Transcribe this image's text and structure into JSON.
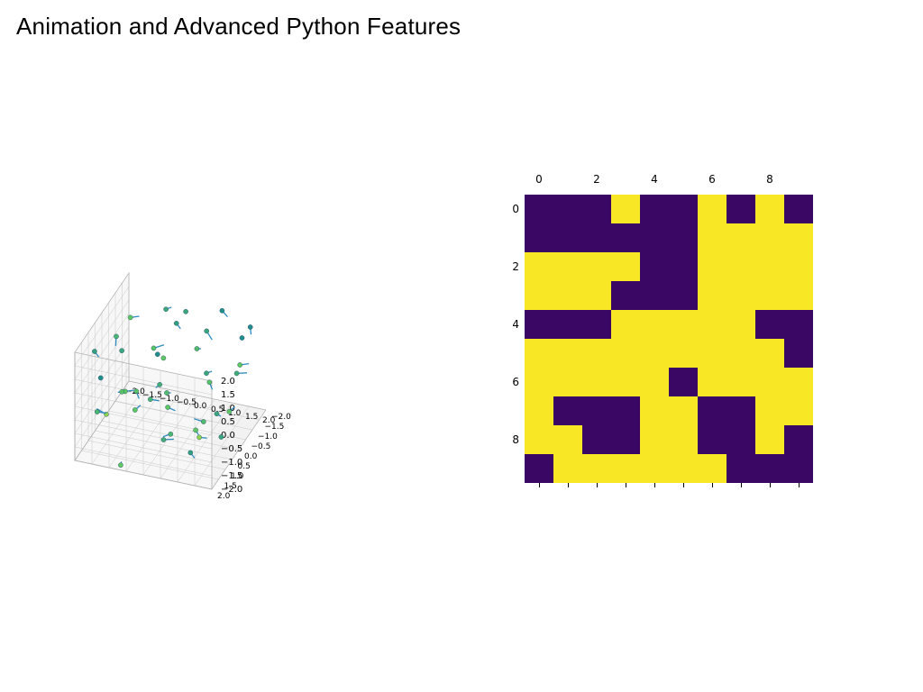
{
  "title": "Animation and Advanced Python Features",
  "chart_data": [
    {
      "type": "scatter",
      "subtype": "3d-quiver",
      "title": "",
      "x_ticks": [
        -2.0,
        -1.5,
        -1.0,
        -0.5,
        0.0,
        0.5,
        1.0,
        1.5,
        2.0
      ],
      "y_ticks": [
        -2.0,
        -1.5,
        -1.0,
        -0.5,
        0.0,
        0.5,
        1.0,
        1.5,
        2.0
      ],
      "z_ticks": [
        -2.0,
        -1.5,
        -1.0,
        -0.5,
        0.0,
        0.5,
        1.0,
        1.5,
        2.0
      ],
      "xlim": [
        -2.0,
        2.0
      ],
      "ylim": [
        -2.0,
        2.0
      ],
      "zlim": [
        -2.0,
        2.0
      ],
      "grid": true,
      "points": [
        {
          "x": -1.8,
          "y": -1.6,
          "z": 0.7,
          "u": 0.3,
          "v": 0.1,
          "w": 0.2
        },
        {
          "x": -1.5,
          "y": 0.2,
          "z": 1.4,
          "u": 0.1,
          "v": 0.3,
          "w": -0.1
        },
        {
          "x": -1.2,
          "y": 1.7,
          "z": -0.3,
          "u": -0.2,
          "v": 0.2,
          "w": 0.3
        },
        {
          "x": -0.9,
          "y": -0.8,
          "z": -1.5,
          "u": 0.3,
          "v": 0.1,
          "w": 0.1
        },
        {
          "x": -0.6,
          "y": 1.0,
          "z": 0.2,
          "u": 0.2,
          "v": 0.3,
          "w": 0.0
        },
        {
          "x": -0.3,
          "y": -1.9,
          "z": 1.1,
          "u": 0.1,
          "v": 0.2,
          "w": 0.2
        },
        {
          "x": 0.0,
          "y": 0.5,
          "z": -1.8,
          "u": 0.3,
          "v": 0.0,
          "w": 0.1
        },
        {
          "x": 0.3,
          "y": -1.2,
          "z": 0.4,
          "u": 0.2,
          "v": 0.2,
          "w": 0.2
        },
        {
          "x": 0.6,
          "y": 1.5,
          "z": -0.7,
          "u": -0.1,
          "v": 0.3,
          "w": 0.1
        },
        {
          "x": 0.9,
          "y": -0.4,
          "z": 1.8,
          "u": 0.2,
          "v": 0.1,
          "w": -0.2
        },
        {
          "x": 1.2,
          "y": 0.9,
          "z": -1.1,
          "u": 0.3,
          "v": 0.2,
          "w": 0.2
        },
        {
          "x": 1.5,
          "y": -1.5,
          "z": 0.9,
          "u": 0.1,
          "v": 0.2,
          "w": 0.1
        },
        {
          "x": 1.8,
          "y": 0.2,
          "z": -0.5,
          "u": 0.2,
          "v": 0.1,
          "w": 0.3
        },
        {
          "x": -1.7,
          "y": 1.3,
          "z": 1.6,
          "u": 0.2,
          "v": 0.2,
          "w": 0.0
        },
        {
          "x": -1.0,
          "y": -1.3,
          "z": 0.0,
          "u": 0.3,
          "v": 0.0,
          "w": 0.2
        },
        {
          "x": 0.4,
          "y": 1.8,
          "z": 1.3,
          "u": 0.0,
          "v": 0.3,
          "w": 0.1
        },
        {
          "x": 1.0,
          "y": -0.9,
          "z": -1.6,
          "u": 0.2,
          "v": 0.2,
          "w": 0.1
        },
        {
          "x": -0.2,
          "y": 0.0,
          "z": 0.8,
          "u": 0.1,
          "v": 0.3,
          "w": 0.2
        },
        {
          "x": 1.6,
          "y": 1.6,
          "z": 0.1,
          "u": -0.2,
          "v": 0.2,
          "w": 0.2
        },
        {
          "x": -1.9,
          "y": 0.6,
          "z": -1.2,
          "u": 0.3,
          "v": 0.1,
          "w": 0.1
        },
        {
          "x": 0.8,
          "y": -1.8,
          "z": 1.5,
          "u": 0.2,
          "v": 0.1,
          "w": -0.1
        },
        {
          "x": -0.7,
          "y": 1.9,
          "z": -1.9,
          "u": 0.1,
          "v": 0.2,
          "w": 0.3
        },
        {
          "x": 1.3,
          "y": 0.4,
          "z": 0.6,
          "u": 0.2,
          "v": 0.3,
          "w": 0.0
        },
        {
          "x": -1.4,
          "y": -0.2,
          "z": -0.9,
          "u": 0.3,
          "v": 0.1,
          "w": 0.2
        },
        {
          "x": 0.1,
          "y": 1.2,
          "z": 1.9,
          "u": 0.1,
          "v": 0.2,
          "w": 0.1
        },
        {
          "x": -0.5,
          "y": -1.0,
          "z": -1.3,
          "u": 0.2,
          "v": 0.2,
          "w": 0.2
        },
        {
          "x": 1.7,
          "y": -0.6,
          "z": 0.3,
          "u": 0.3,
          "v": 0.0,
          "w": 0.1
        },
        {
          "x": -1.1,
          "y": 0.8,
          "z": -0.1,
          "u": 0.0,
          "v": 0.3,
          "w": 0.2
        },
        {
          "x": 0.5,
          "y": -1.4,
          "z": -0.6,
          "u": 0.2,
          "v": 0.1,
          "w": 0.2
        },
        {
          "x": -1.6,
          "y": 1.1,
          "z": 0.5,
          "u": 0.1,
          "v": 0.2,
          "w": 0.1
        },
        {
          "x": 1.1,
          "y": 1.3,
          "z": -1.4,
          "u": 0.2,
          "v": 0.2,
          "w": 0.0
        },
        {
          "x": -0.8,
          "y": -1.7,
          "z": 1.2,
          "u": 0.2,
          "v": 0.1,
          "w": 0.2
        },
        {
          "x": 0.2,
          "y": 0.7,
          "z": -0.4,
          "u": 0.3,
          "v": 0.2,
          "w": 0.1
        },
        {
          "x": 1.9,
          "y": -1.1,
          "z": 1.7,
          "u": 0.1,
          "v": 0.2,
          "w": -0.1
        },
        {
          "x": -0.4,
          "y": 1.6,
          "z": 0.0,
          "u": 0.2,
          "v": 0.1,
          "w": 0.3
        },
        {
          "x": 0.7,
          "y": -0.1,
          "z": -1.7,
          "u": 0.2,
          "v": 0.3,
          "w": 0.1
        },
        {
          "x": -1.3,
          "y": 0.3,
          "z": 1.0,
          "u": 0.1,
          "v": 0.2,
          "w": 0.2
        },
        {
          "x": 1.4,
          "y": -1.6,
          "z": -0.2,
          "u": 0.3,
          "v": 0.1,
          "w": 0.2
        },
        {
          "x": -0.1,
          "y": -0.7,
          "z": 1.6,
          "u": 0.2,
          "v": 0.2,
          "w": 0.0
        },
        {
          "x": 1.8,
          "y": 0.8,
          "z": -1.0,
          "u": 0.1,
          "v": 0.2,
          "w": 0.2
        }
      ]
    },
    {
      "type": "heatmap",
      "title": "",
      "x_ticks": [
        0,
        2,
        4,
        6,
        8
      ],
      "y_ticks": [
        0,
        2,
        4,
        6,
        8
      ],
      "xlim": [
        0,
        9
      ],
      "ylim": [
        0,
        9
      ],
      "colormap": "viridis",
      "grid": [
        [
          0,
          0,
          0,
          1,
          0,
          0,
          1,
          0,
          1,
          0
        ],
        [
          0,
          0,
          0,
          0,
          0,
          0,
          1,
          1,
          1,
          1
        ],
        [
          1,
          1,
          1,
          1,
          0,
          0,
          1,
          1,
          1,
          1
        ],
        [
          1,
          1,
          1,
          0,
          0,
          0,
          1,
          1,
          1,
          1
        ],
        [
          0,
          0,
          0,
          1,
          1,
          1,
          1,
          1,
          0,
          0
        ],
        [
          1,
          1,
          1,
          1,
          1,
          1,
          1,
          1,
          1,
          0
        ],
        [
          1,
          1,
          1,
          1,
          1,
          0,
          1,
          1,
          1,
          1
        ],
        [
          1,
          0,
          0,
          0,
          1,
          1,
          0,
          0,
          1,
          1
        ],
        [
          1,
          1,
          0,
          0,
          1,
          1,
          0,
          0,
          1,
          0
        ],
        [
          0,
          1,
          1,
          1,
          1,
          1,
          1,
          0,
          0,
          0
        ]
      ]
    }
  ]
}
